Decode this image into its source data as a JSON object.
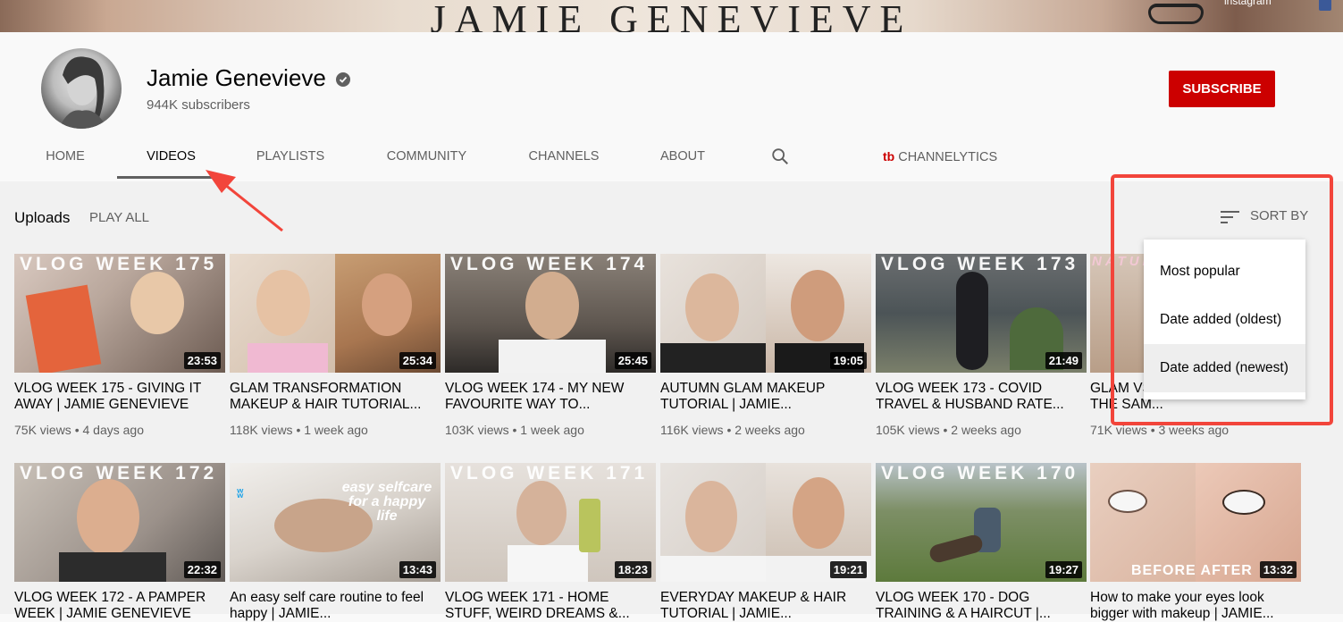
{
  "banner": {
    "title": "JAMIE GENEVIEVE",
    "instagram": "instagram"
  },
  "channel": {
    "name": "Jamie Genevieve",
    "subscribers": "944K subscribers",
    "subscribe_label": "SUBSCRIBE"
  },
  "tabs": [
    "HOME",
    "VIDEOS",
    "PLAYLISTS",
    "COMMUNITY",
    "CHANNELS",
    "ABOUT"
  ],
  "active_tab": "VIDEOS",
  "channelytics": {
    "logo": "tb",
    "label": "CHANNELYTICS"
  },
  "uploads": {
    "label": "Uploads",
    "play_all": "PLAY ALL",
    "sort_by": "SORT BY"
  },
  "sort_menu": {
    "options": [
      "Most popular",
      "Date added (oldest)",
      "Date added (newest)"
    ],
    "highlighted": "Date added (newest)"
  },
  "videos": [
    {
      "thumb_text": "VLOG WEEK 175",
      "duration": "23:53",
      "title": "VLOG WEEK 175 - GIVING IT AWAY | JAMIE GENEVIEVE",
      "meta": "75K views • 4 days ago"
    },
    {
      "thumb_text": "",
      "duration": "25:34",
      "title": "GLAM TRANSFORMATION MAKEUP & HAIR TUTORIAL...",
      "meta": "118K views • 1 week ago"
    },
    {
      "thumb_text": "VLOG WEEK 174",
      "duration": "25:45",
      "title": "VLOG WEEK 174 - MY NEW FAVOURITE WAY TO...",
      "meta": "103K views • 1 week ago"
    },
    {
      "thumb_text": "",
      "duration": "19:05",
      "title": "AUTUMN GLAM MAKEUP TUTORIAL | JAMIE...",
      "meta": "116K views • 2 weeks ago"
    },
    {
      "thumb_text": "VLOG WEEK 173",
      "duration": "21:49",
      "title": "VLOG WEEK 173 - COVID TRAVEL & HUSBAND RATE...",
      "meta": "105K views • 2 weeks ago"
    },
    {
      "thumb_text": "NATUR",
      "duration": "",
      "title": "GLAM VS ... MAKEUP... USING THE SAM...",
      "meta": "71K views • 3 weeks ago"
    },
    {
      "thumb_text": "VLOG WEEK 172",
      "duration": "22:32",
      "title": "VLOG WEEK 172 - A PAMPER WEEK | JAMIE GENEVIEVE",
      "meta": ""
    },
    {
      "thumb_text": "easy selfcare for a happy life",
      "duration": "13:43",
      "title": "An easy self care routine to feel happy | JAMIE...",
      "meta": ""
    },
    {
      "thumb_text": "VLOG WEEK 171",
      "duration": "18:23",
      "title": "VLOG WEEK 171 - HOME STUFF, WEIRD DREAMS &...",
      "meta": ""
    },
    {
      "thumb_text": "",
      "duration": "19:21",
      "title": "EVERYDAY MAKEUP & HAIR TUTORIAL | JAMIE...",
      "meta": ""
    },
    {
      "thumb_text": "VLOG WEEK 170",
      "duration": "19:27",
      "title": "VLOG WEEK 170 - DOG TRAINING & A HAIRCUT |...",
      "meta": ""
    },
    {
      "thumb_text": "BEFORE AFTER",
      "duration": "13:32",
      "title": "How to make your eyes look bigger with makeup | JAMIE...",
      "meta": ""
    }
  ],
  "colors": {
    "subscribe": "#cc0000",
    "annotation": "#f2453b",
    "background": "#f1f1f1"
  }
}
